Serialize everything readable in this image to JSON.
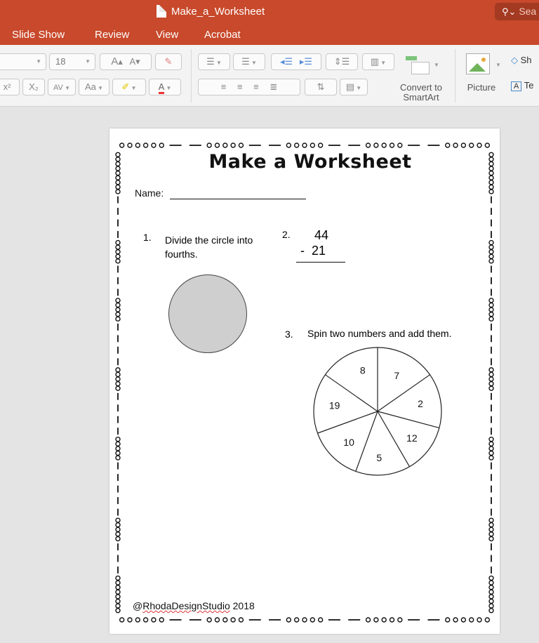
{
  "window": {
    "title": "Make_a_Worksheet",
    "search_placeholder": "Sea"
  },
  "menu": [
    "Slide Show",
    "Review",
    "View",
    "Acrobat"
  ],
  "ribbon": {
    "font_size": "18",
    "grow_font": "A",
    "shrink_font": "A",
    "superscript": "x²",
    "subscript": "X₂",
    "char_spacing": "AV",
    "change_case": "Aa",
    "font_color": "A",
    "convert_smartart": "Convert to\nSmartArt",
    "picture": "Picture",
    "shapes": "Sh",
    "textbox": "Te"
  },
  "worksheet": {
    "title": "Make a Worksheet",
    "name_label": "Name:",
    "q1_number": "1.",
    "q1_text": "Divide the circle into fourths.",
    "q2_number": "2.",
    "q2_top": "44",
    "q2_bottom": "-  21",
    "q3_number": "3.",
    "q3_text": "Spin two numbers and add them.",
    "spinner_numbers": [
      "8",
      "7",
      "2",
      "12",
      "5",
      "10",
      "19"
    ],
    "credit_prefix": "@",
    "credit_underlined": "RhodaDesignStudio",
    "credit_suffix": " 2018"
  },
  "colors": {
    "accent": "#c8492b",
    "circle_fill": "#cfcfcf"
  }
}
